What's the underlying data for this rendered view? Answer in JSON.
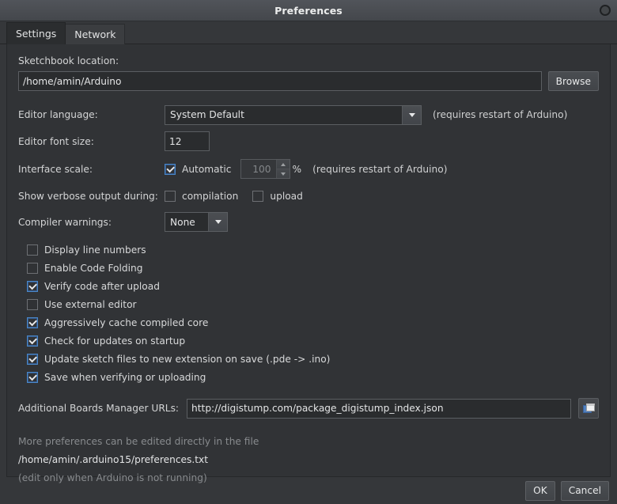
{
  "window": {
    "title": "Preferences",
    "close_icon": "circle-close-icon"
  },
  "tabs": [
    {
      "label": "Settings",
      "active": true
    },
    {
      "label": "Network",
      "active": false
    }
  ],
  "settings": {
    "sketchbook": {
      "label": "Sketchbook location:",
      "value": "/home/amin/Arduino",
      "placeholder": "",
      "browse_label": "Browse"
    },
    "editor_language": {
      "label": "Editor language:",
      "value": "System Default",
      "note": "(requires restart of Arduino)"
    },
    "editor_font_size": {
      "label": "Editor font size:",
      "value": "12"
    },
    "interface_scale": {
      "label": "Interface scale:",
      "automatic_label": "Automatic",
      "automatic_checked": true,
      "scale_value": "100",
      "percent_symbol": "%",
      "note": "(requires restart of Arduino)"
    },
    "verbose_output": {
      "label": "Show verbose output during:",
      "compilation_label": "compilation",
      "compilation_checked": false,
      "upload_label": "upload",
      "upload_checked": false
    },
    "compiler_warnings": {
      "label": "Compiler warnings:",
      "value": "None"
    },
    "checkboxes": [
      {
        "label": "Display line numbers",
        "checked": false
      },
      {
        "label": "Enable Code Folding",
        "checked": false
      },
      {
        "label": "Verify code after upload",
        "checked": true
      },
      {
        "label": "Use external editor",
        "checked": false
      },
      {
        "label": "Aggressively cache compiled core",
        "checked": true
      },
      {
        "label": "Check for updates on startup",
        "checked": true
      },
      {
        "label": "Update sketch files to new extension on save (.pde -> .ino)",
        "checked": true
      },
      {
        "label": "Save when verifying or uploading",
        "checked": true
      }
    ],
    "boards_manager": {
      "label": "Additional Boards Manager URLs:",
      "value": "http://digistump.com/package_digistump_index.json",
      "placeholder": "",
      "expand_icon": "window-expand-icon"
    },
    "footer": {
      "line1": "More preferences can be edited directly in the file",
      "line2": "/home/amin/.arduino15/preferences.txt",
      "line3": "(edit only when Arduino is not running)"
    }
  },
  "footer_buttons": {
    "ok_label": "OK",
    "cancel_label": "Cancel"
  },
  "colors": {
    "accent": "#4a87c8",
    "window_bg": "#35373a",
    "panel_bg": "#313336",
    "titlebar_bg": "#4a4d52"
  }
}
